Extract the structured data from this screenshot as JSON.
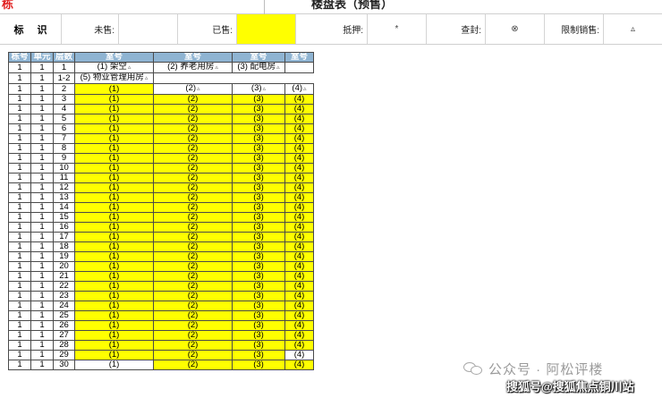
{
  "header": {
    "red_title": "栋",
    "dark_title": "楼盘表（预售）"
  },
  "legend": {
    "title": "标 识",
    "items": [
      {
        "label": "未售:",
        "value": ""
      },
      {
        "label": "已售:",
        "value": ""
      },
      {
        "label": "抵押:",
        "value": "*"
      },
      {
        "label": "查封:",
        "value": "⊗"
      },
      {
        "label": "限制销售:",
        "value": "▵"
      }
    ],
    "colors": {
      "sold": "#ffff00",
      "header": "#8fb4d2"
    }
  },
  "table": {
    "headers": [
      "栋号",
      "单元",
      "层数",
      "室号",
      "室号",
      "室号",
      "室号"
    ],
    "special_rows": [
      {
        "bld": "1",
        "unit": "1",
        "floor": "1",
        "cells": [
          "(1) 架空",
          "(2) 养老用房",
          "(3) 配电房",
          ""
        ]
      },
      {
        "bld": "1",
        "unit": "1",
        "floor": "1-2",
        "cells": [
          "(5) 物业管理用房",
          "",
          "",
          ""
        ]
      },
      {
        "bld": "1",
        "unit": "1",
        "floor": "2",
        "cells": [
          "(1)",
          "(2)",
          "(3)",
          "(4)"
        ]
      }
    ],
    "bld": "1",
    "unit": "1",
    "rooms": [
      "(1)",
      "(2)",
      "(3)",
      "(4)"
    ],
    "floors_from": 3,
    "floors_to": 30
  },
  "watermark": {
    "text": "公众号 · 阿松评楼",
    "icon": "wechat-icon",
    "source": "搜狐号@搜狐焦点铜川站"
  }
}
